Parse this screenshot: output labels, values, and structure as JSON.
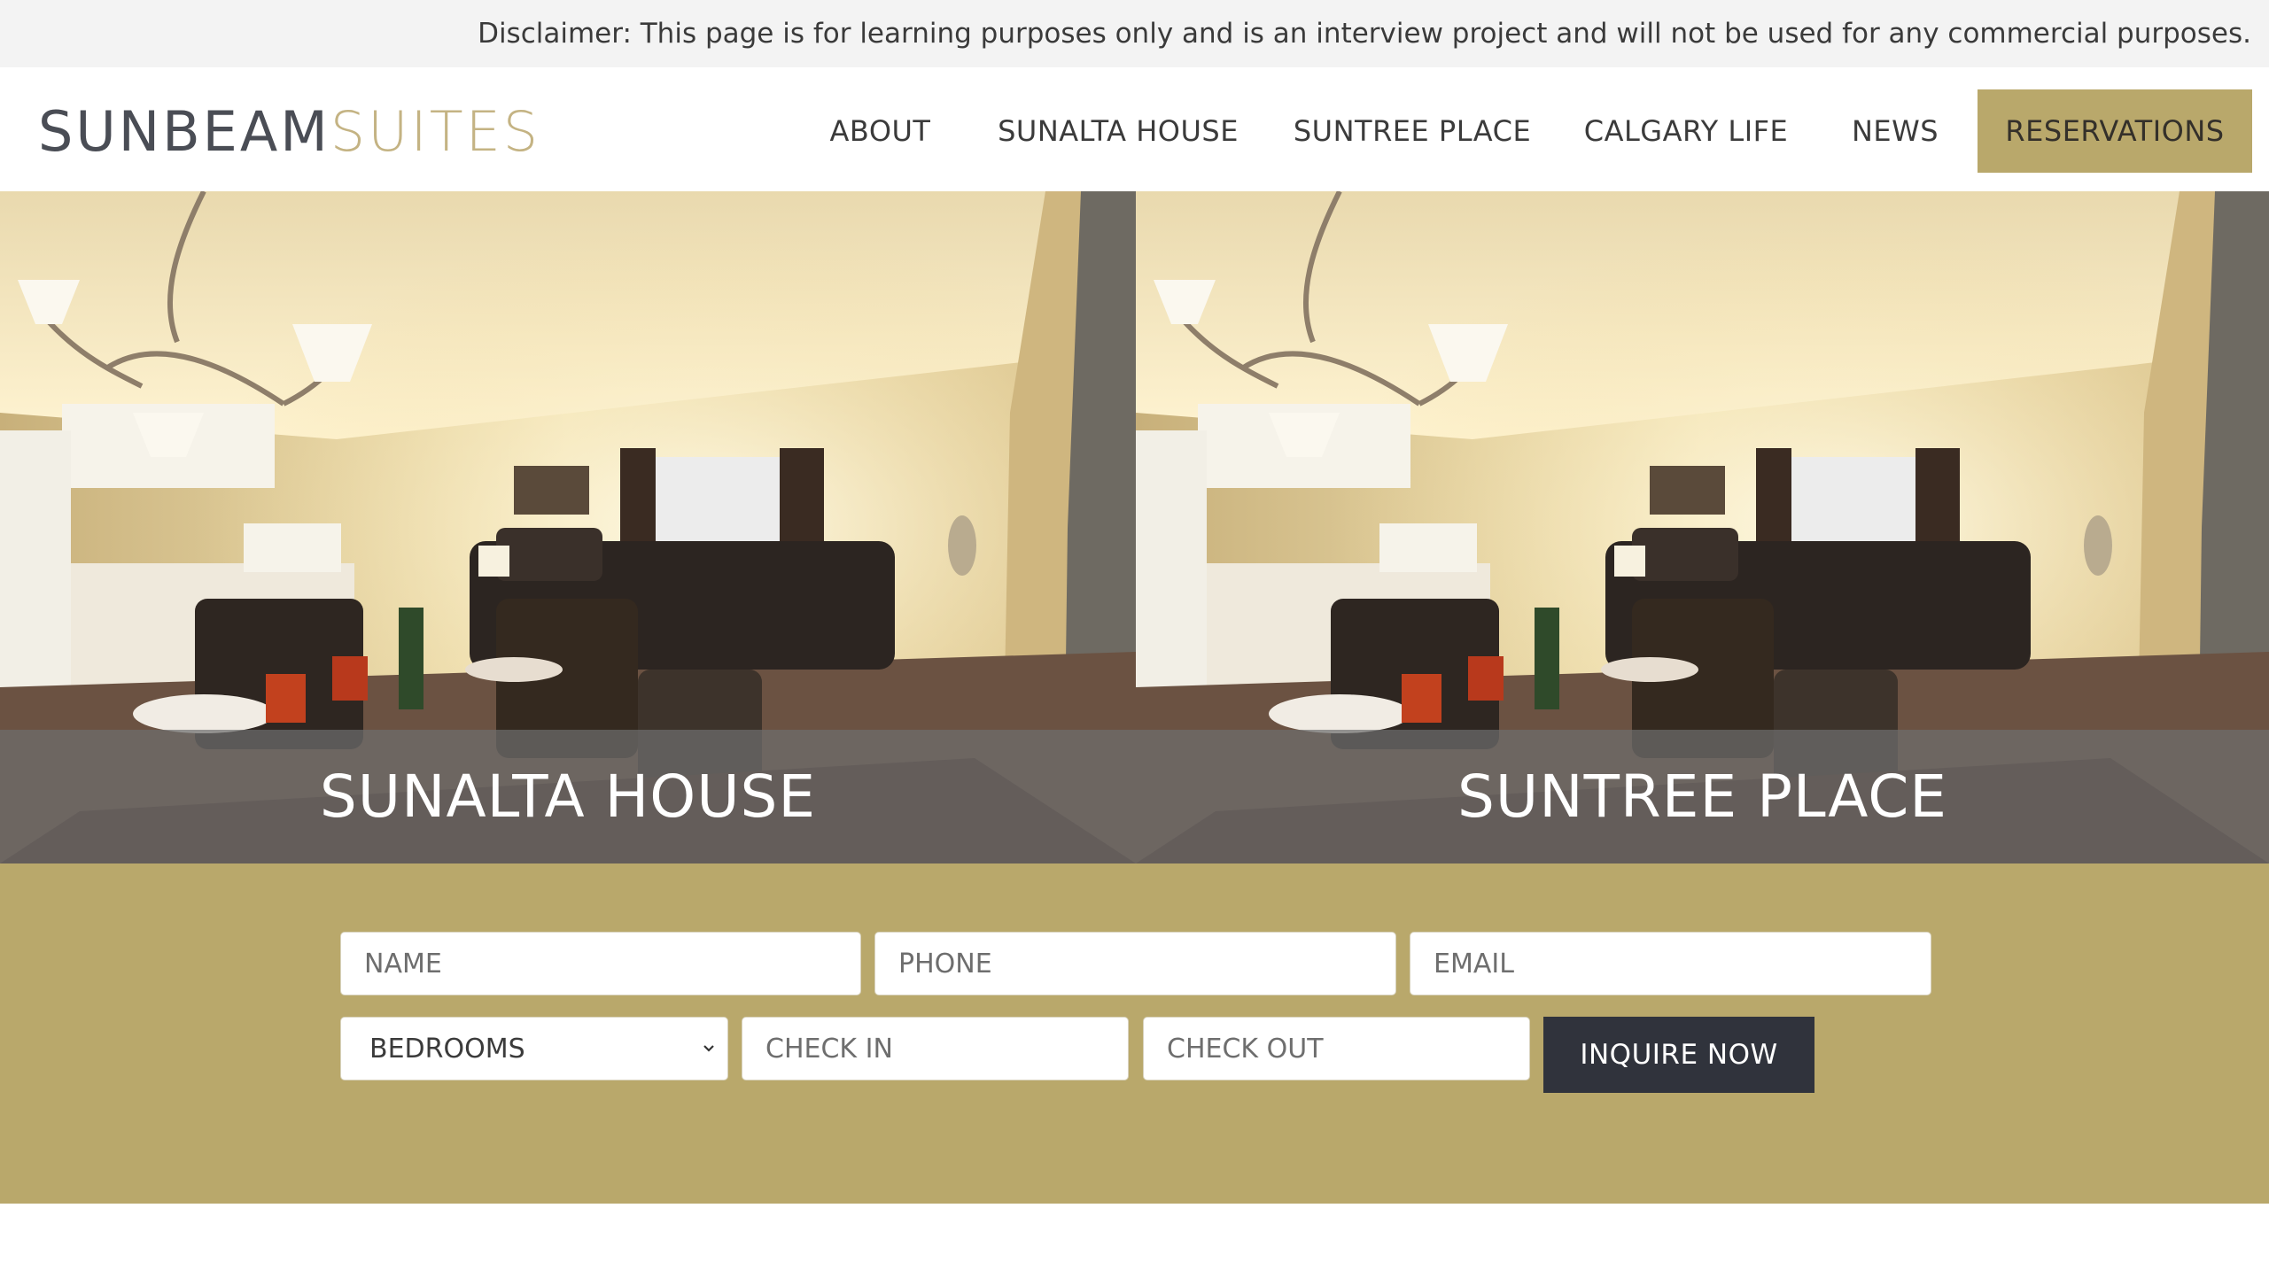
{
  "disclaimer": "Disclaimer: This page is for learning purposes only and is an interview project and will not be used for any commercial purposes.",
  "logo": {
    "part1": "SUNBEAM",
    "part2": "SUITES"
  },
  "nav": {
    "about": "ABOUT",
    "sunalta": "SUNALTA HOUSE",
    "suntree": "SUNTREE PLACE",
    "calgary": "CALGARY LIFE",
    "news": "NEWS",
    "reservations": "RESERVATIONS"
  },
  "hero": {
    "left_caption": "SUNALTA HOUSE",
    "right_caption": "SUNTREE PLACE"
  },
  "form": {
    "name_placeholder": "NAME",
    "phone_placeholder": "PHONE",
    "email_placeholder": "EMAIL",
    "bedrooms_selected": "BEDROOMS",
    "checkin_placeholder": "CHECK IN",
    "checkout_placeholder": "CHECK OUT",
    "submit_label": "INQUIRE NOW"
  },
  "colors": {
    "accent": "#b9a86b",
    "dark_button": "#30333c",
    "logo_dark": "#4a4d55",
    "logo_light": "#c4b383"
  },
  "icons": [
    "chevron-down-icon"
  ]
}
